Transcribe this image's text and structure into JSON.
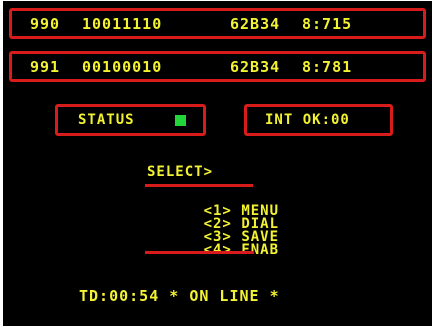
{
  "readouts": [
    {
      "channel": "990",
      "bits": "10011110",
      "code": "62B34",
      "value": "8:715"
    },
    {
      "channel": "991",
      "bits": "00100010",
      "code": "62B34",
      "value": "8:781"
    }
  ],
  "status": {
    "label": "STATUS",
    "led_color": "#22d63a"
  },
  "interrupt": {
    "label": "INT OK:00"
  },
  "menu": {
    "title": "SELECT>",
    "items": [
      {
        "key": "<1>",
        "label": "MENU"
      },
      {
        "key": "<2>",
        "label": "DIAL"
      },
      {
        "key": "<3>",
        "label": "SAVE"
      },
      {
        "key": "<4>",
        "label": "ENAB"
      }
    ]
  },
  "footer": {
    "text": "TD:00:54 * ON LINE *"
  },
  "colors": {
    "background": "#000000",
    "text": "#f2f233",
    "frame": "#d81c1c",
    "led": "#22d63a"
  }
}
